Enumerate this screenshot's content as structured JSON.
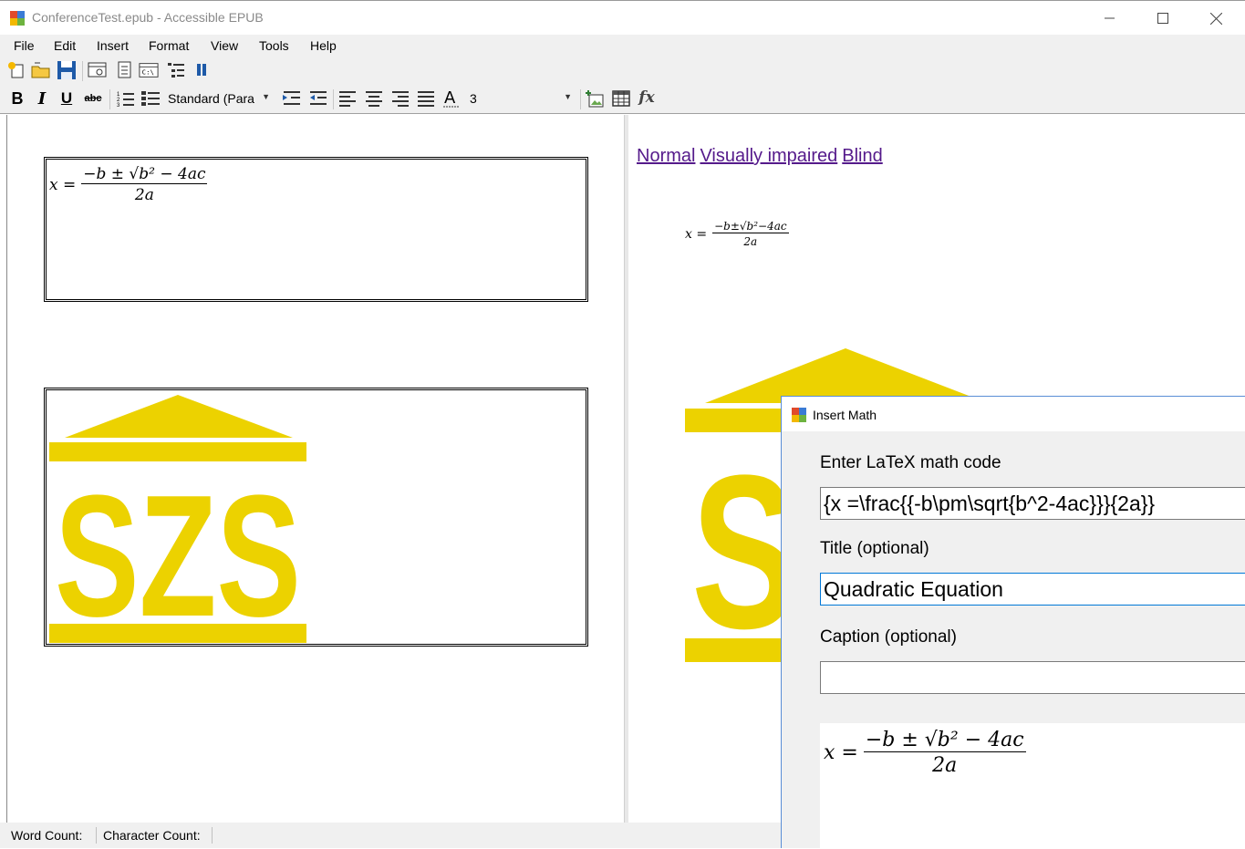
{
  "window": {
    "title": "ConferenceTest.epub - Accessible EPUB"
  },
  "menu": [
    "File",
    "Edit",
    "Insert",
    "Format",
    "View",
    "Tools",
    "Help"
  ],
  "toolbar2": {
    "style_value": "Standard (Para",
    "size_value": "3"
  },
  "left_editor": {
    "math_x": "x =",
    "math_num": "−b ± √b² − 4ac",
    "math_den": "2a",
    "logo_text": "SZS"
  },
  "right_preview": {
    "links": [
      "Normal",
      "Visually impaired",
      "Blind"
    ],
    "math_x": "x =",
    "math_num": "−b±√b²−4ac",
    "math_den": "2a",
    "logo_text": "SZS"
  },
  "status": {
    "word_count": "Word Count:",
    "char_count": "Character Count:"
  },
  "dialog": {
    "title": "Insert Math",
    "latex_label": "Enter LaTeX math code",
    "latex_value": "{x =\\frac{{-b\\pm\\sqrt{b^2-4ac}}}{2a}}",
    "title_label": "Title (optional)",
    "title_value": "Quadratic Equation",
    "caption_label": "Caption (optional)",
    "caption_value": "",
    "preview_x": "x =",
    "preview_num": "−b ± √b² − 4ac",
    "preview_den": "2a"
  },
  "colors": {
    "logo": "#ecd200",
    "link": "#551a8b",
    "chrome": "#f0f0f0"
  }
}
